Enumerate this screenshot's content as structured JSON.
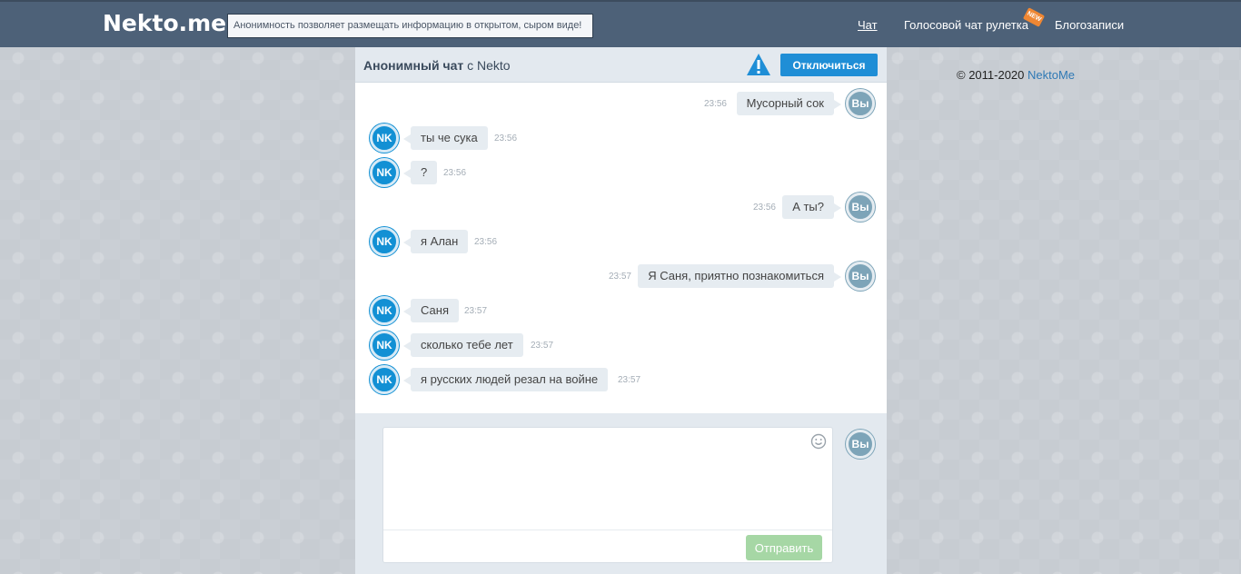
{
  "header": {
    "logo": "Nekto.me",
    "slogan": "Анонимность позволяет размещать информацию в открытом, сыром виде!",
    "nav": {
      "chat": "Чат",
      "voice": "Голосовой чат рулетка",
      "new_badge": "NEW",
      "blog": "Блогозаписи"
    }
  },
  "chat": {
    "title_bold": "Анонимный чат",
    "title_rest": " с Nekto",
    "warning_icon": "warning-triangle-icon",
    "disconnect_label": "Отключиться",
    "messages": [
      {
        "from": "me",
        "avatar": "Вы",
        "text": "Мусорный сок",
        "time": "23:56"
      },
      {
        "from": "nk",
        "avatar": "NK",
        "text": "ты че сука",
        "time": "23:56"
      },
      {
        "from": "nk",
        "avatar": "NK",
        "text": "?",
        "time": "23:56"
      },
      {
        "from": "me",
        "avatar": "Вы",
        "text": "А ты?",
        "time": "23:56"
      },
      {
        "from": "nk",
        "avatar": "NK",
        "text": "я Алан",
        "time": "23:56"
      },
      {
        "from": "me",
        "avatar": "Вы",
        "text": "Я Саня, приятно познакомиться",
        "time": "23:57"
      },
      {
        "from": "nk",
        "avatar": "NK",
        "text": "Саня",
        "time": "23:57"
      },
      {
        "from": "nk",
        "avatar": "NK",
        "text": "сколько тебе лет",
        "time": "23:57"
      },
      {
        "from": "nk",
        "avatar": "NK",
        "text": "я русских людей резал на войне",
        "time": "23:57"
      }
    ],
    "composer": {
      "value": "",
      "avatar": "Вы",
      "send_label": "Отправить",
      "emoji_icon": "smile-icon"
    }
  },
  "footer": {
    "copyright": "© 2011-2020 ",
    "copyright_link": "NektoMe"
  },
  "colors": {
    "header_bg": "#4d6178",
    "accent_blue": "#1f8ed6",
    "nk_avatar": "#1290d4",
    "me_avatar": "#7da4b8",
    "send_button": "#a6d7a5"
  }
}
